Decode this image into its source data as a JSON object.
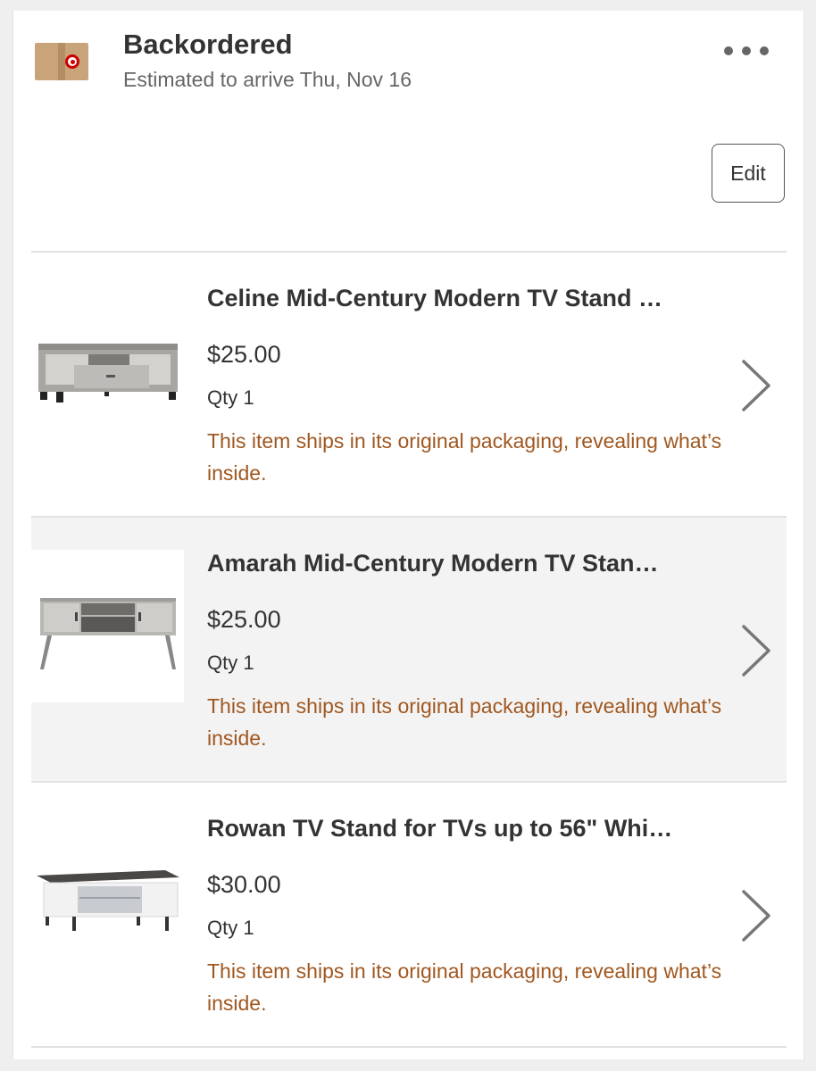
{
  "header": {
    "status": "Backordered",
    "eta": "Estimated to arrive Thu, Nov 16",
    "icon": "target-package-icon",
    "more_icon": "more-horizontal-icon"
  },
  "toolbar": {
    "edit_label": "Edit"
  },
  "items": [
    {
      "title": "Celine Mid-Century Modern TV Stand …",
      "price": "$25.00",
      "qty": "Qty 1",
      "note": "This item ships in its original packaging, revealing what’s inside."
    },
    {
      "title": "Amarah Mid-Century Modern TV Stan…",
      "price": "$25.00",
      "qty": "Qty 1",
      "note": "This item ships in its original packaging, revealing what’s inside."
    },
    {
      "title": "Rowan TV Stand for TVs up to 56\" Whi…",
      "price": "$30.00",
      "qty": "Qty 1",
      "note": "This item ships in its original packaging, revealing what’s inside."
    }
  ],
  "colors": {
    "note": "#a0571f",
    "brand_red": "#cc0000",
    "selected_row": "#f3f3f3"
  }
}
